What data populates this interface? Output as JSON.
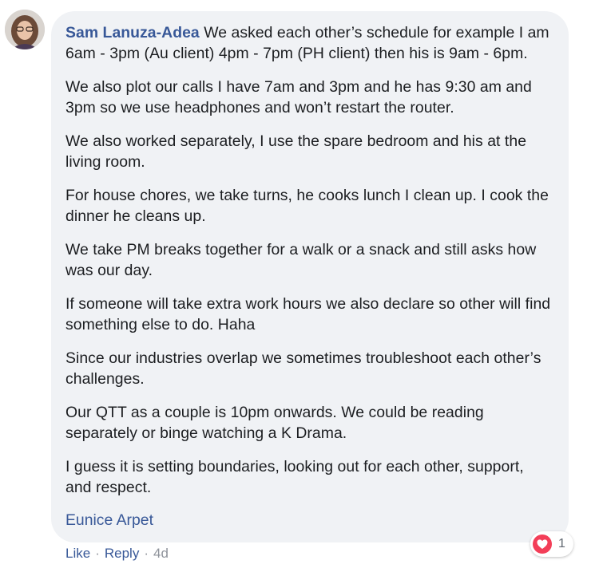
{
  "comment": {
    "author": "Sam Lanuza-Adea",
    "paragraphs": [
      "We asked each other’s schedule for example I am 6am - 3pm (Au client) 4pm - 7pm (PH client) then his is 9am - 6pm.",
      "We also plot our calls I have 7am and 3pm and he has 9:30 am and 3pm so we use headphones and won’t restart the router.",
      "We also worked separately, I use the spare bedroom and his at the living room.",
      "For house chores, we take turns, he cooks lunch I clean up. I cook the dinner he cleans up.",
      "We take PM breaks together for a walk or a snack and still asks how was our day.",
      "If someone will take extra work hours we also declare so other will find something else to do. Haha",
      "Since our industries overlap we sometimes troubleshoot each other’s challenges.",
      "Our QTT as a couple is 10pm onwards. We could be reading separately or binge watching a K Drama.",
      "I guess it is setting boundaries, looking out for each other, support, and respect."
    ],
    "mention": "Eunice Arpet"
  },
  "actions": {
    "like_label": "Like",
    "separator": "·",
    "reply_label": "Reply",
    "time": "4d"
  },
  "reactions": {
    "icon": "heart-icon",
    "count": "1",
    "color": "#f33e58"
  },
  "colors": {
    "link": "#385898",
    "bubble": "#f0f2f5",
    "meta": "#90949c"
  }
}
